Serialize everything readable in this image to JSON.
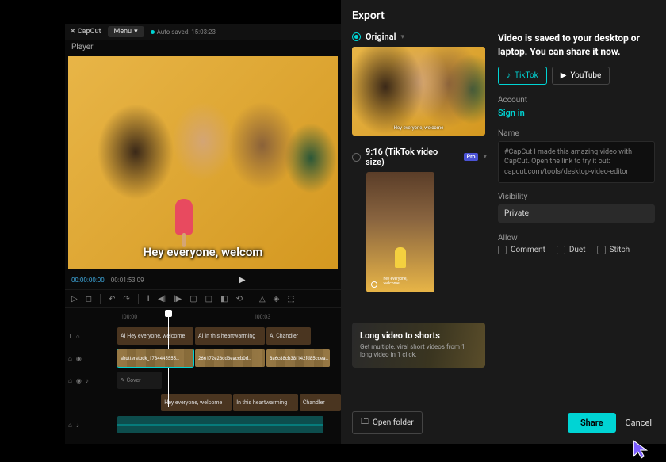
{
  "editor": {
    "logo": "✕ CapCut",
    "menu": "Menu",
    "autosave": "Auto saved: 15:03:23",
    "player_label": "Player",
    "caption": "Hey everyone, welcom",
    "timecode_current": "00:00:00:00",
    "timecode_total": "00:01:53:09",
    "ruler": [
      "|00:00",
      "|00:03"
    ],
    "text_clips": [
      "AI Hey everyone, welcome",
      "AI In this heartwarming",
      "AI Chandler"
    ],
    "video_clip": "shutterstock_1734445555…",
    "video_ids": [
      "266172e26dd6eaccb0d…",
      "8a6c88cb38f142fd85cdea…"
    ],
    "cover": "✎ Cover",
    "caption_clips": [
      "Hey everyone, welcome",
      "In this heartwarming",
      "Chandler"
    ]
  },
  "export": {
    "title": "Export",
    "original": "Original",
    "tiktok_size": "9:16 (TikTok video size)",
    "pro": "Pro",
    "mini_caption": "Hey everyone, welcome",
    "mini_caption2": "hey everyone, welcome",
    "promo_title": "Long video to shorts",
    "promo_sub": "Get multiple, viral short videos from 1 long video in 1 click.",
    "saved_msg": "Video is saved to your desktop or laptop. You can share it now.",
    "tiktok": "TikTok",
    "youtube": "YouTube",
    "account": "Account",
    "signin": "Sign in",
    "name_label": "Name",
    "name_value": "#CapCut I made this amazing video with CapCut. Open the link to try it out: capcut.com/tools/desktop-video-editor",
    "visibility_label": "Visibility",
    "visibility_value": "Private",
    "allow_label": "Allow",
    "allow_comment": "Comment",
    "allow_duet": "Duet",
    "allow_stitch": "Stitch",
    "open_folder": "Open folder",
    "share": "Share",
    "cancel": "Cancel"
  }
}
